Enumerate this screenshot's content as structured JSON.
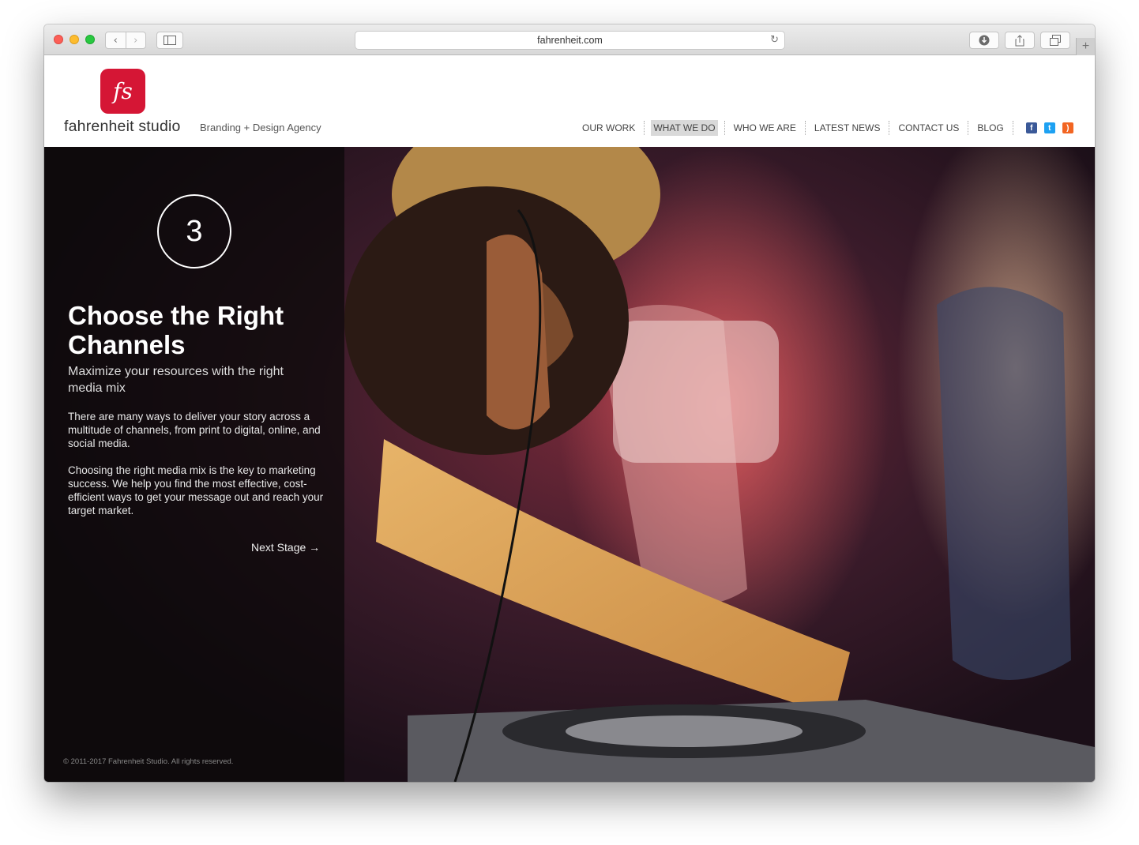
{
  "browser": {
    "url": "fahrenheit.com"
  },
  "site": {
    "logo_mark": "fs",
    "logo_text": "fahrenheit studio",
    "tagline": "Branding + Design Agency"
  },
  "nav": {
    "items": [
      {
        "label": "OUR WORK"
      },
      {
        "label": "WHAT WE DO",
        "active": true
      },
      {
        "label": "WHO WE ARE"
      },
      {
        "label": "LATEST NEWS"
      },
      {
        "label": "CONTACT US"
      },
      {
        "label": "BLOG"
      }
    ],
    "social": [
      {
        "icon": "facebook-icon",
        "glyph": "f",
        "color": "#3b5998"
      },
      {
        "icon": "twitter-icon",
        "glyph": "t",
        "color": "#1da1f2"
      },
      {
        "icon": "rss-icon",
        "glyph": ")",
        "color": "#f26522"
      }
    ]
  },
  "hero": {
    "step_number": "3",
    "title": "Choose the Right Channels",
    "subtitle": "Maximize your resources with the right media mix",
    "paragraph_1": "There are many ways to deliver your story across a multitude of channels, from print to digital, online, and social media.",
    "paragraph_2": "Choosing the right media mix is the key to marketing success. We help you find the most effective, cost-efficient ways to get your message out and reach your target market.",
    "next_label": "Next Stage →"
  },
  "footer": {
    "copyright": "© 2011-2017 Fahrenheit Studio. All rights reserved."
  },
  "colors": {
    "brand_red": "#d51635",
    "panel_bg": "rgba(10,8,8,0.72)"
  }
}
